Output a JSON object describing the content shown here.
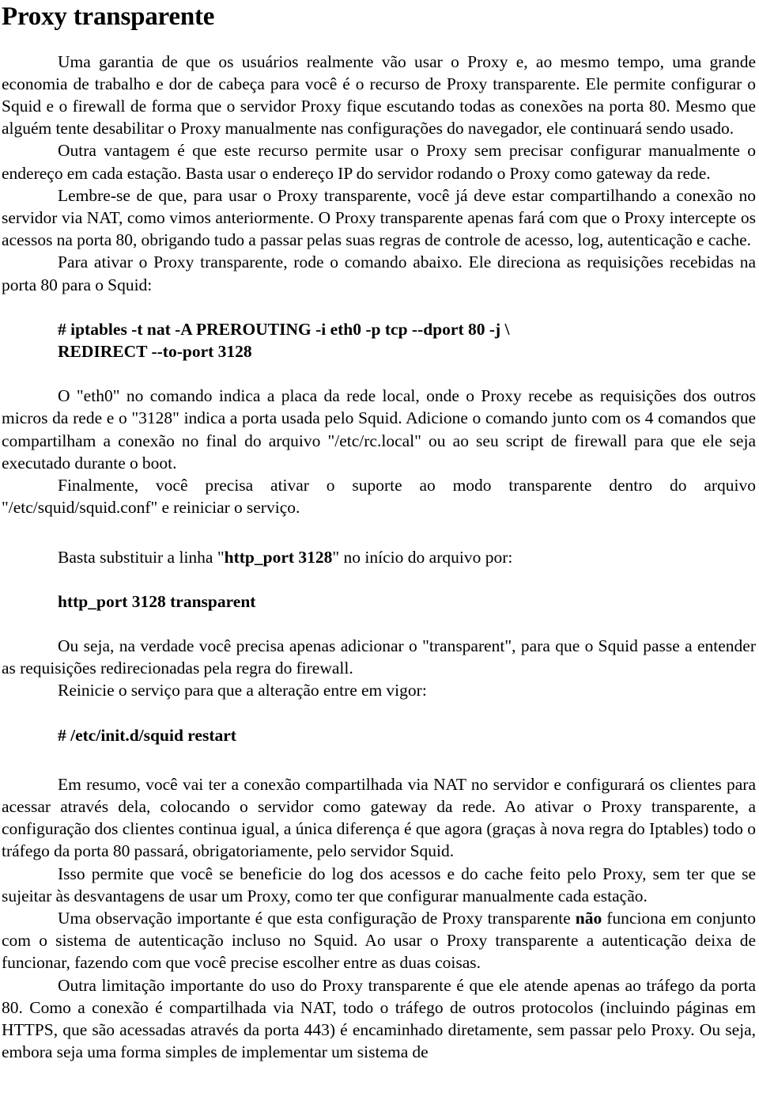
{
  "document": {
    "title": "Proxy transparente",
    "language": "pt-BR",
    "colors": {
      "background": "#ffffff",
      "text": "#000000"
    },
    "blocks": {
      "p1": "Uma garantia de que os usuários realmente vão usar o Proxy e, ao mesmo tempo, uma grande economia de trabalho e dor de cabeça para você é o recurso de Proxy transparente. Ele permite configurar o Squid e o firewall de forma que o servidor Proxy fique escutando todas as conexões na porta 80. Mesmo que alguém tente desabilitar o Proxy manualmente nas configurações do navegador, ele continuará sendo usado.",
      "p2": "Outra vantagem é que este recurso permite usar o Proxy sem precisar configurar manualmente o endereço em cada estação. Basta usar o endereço IP do servidor rodando o Proxy como gateway da rede.",
      "p3": "Lembre-se de que, para usar o Proxy transparente, você já deve estar compartilhando a conexão no servidor via NAT, como vimos anteriormente. O Proxy transparente apenas fará com que o Proxy intercepte os acessos na porta 80, obrigando tudo a passar pelas suas regras de controle de acesso, log, autenticação e cache.",
      "p4": "Para ativar o Proxy transparente, rode o comando abaixo. Ele direciona as requisições recebidas na porta 80 para o Squid:",
      "cmd1_line1": "# iptables -t nat -A PREROUTING -i eth0 -p tcp --dport 80 -j \\",
      "cmd1_line2": "REDIRECT --to-port 3128",
      "p5": "O \"eth0\" no comando indica a placa da rede local, onde o Proxy recebe as requisições dos outros micros da rede e o \"3128\" indica a porta usada pelo Squid. Adicione o comando junto com os 4 comandos que compartilham a conexão no final do arquivo \"/etc/rc.local\" ou ao seu script de firewall para que ele seja executado durante o boot.",
      "p6": "Finalmente, você precisa ativar o suporte ao modo transparente dentro do arquivo \"/etc/squid/squid.conf\" e reiniciar o serviço.",
      "p7_before": "Basta substituir a linha \"",
      "p7_bold": "http_port 3128",
      "p7_after": "\" no início do arquivo por:",
      "cmd2": "http_port 3128 transparent",
      "p8": "Ou seja, na verdade você precisa apenas adicionar o \"transparent\", para que o Squid passe a entender as requisições redirecionadas pela regra do firewall.",
      "p9": "Reinicie o serviço para que a alteração entre em vigor:",
      "cmd3": "# /etc/init.d/squid restart",
      "p10": "Em resumo, você vai ter a conexão compartilhada via NAT no servidor e configurará os clientes para acessar através dela, colocando o servidor como gateway da rede. Ao ativar o Proxy transparente, a configuração dos clientes continua igual, a única diferença é que agora (graças à nova regra do Iptables) todo o tráfego da porta 80 passará, obrigatoriamente, pelo servidor Squid.",
      "p11": "Isso permite que você se beneficie do log dos acessos e do cache feito pelo Proxy, sem ter que se sujeitar às desvantagens de usar um Proxy, como ter que configurar manualmente cada estação.",
      "p12_before": "Uma observação importante é que esta configuração de Proxy transparente ",
      "p12_bold": "não",
      "p12_after": " funciona em conjunto com o sistema de autenticação incluso no Squid. Ao usar o Proxy transparente a autenticação deixa de funcionar, fazendo com que você precise escolher entre as duas coisas.",
      "p13": "Outra limitação importante do uso do Proxy transparente é que ele atende apenas ao tráfego da porta 80. Como a conexão é compartilhada via NAT, todo o tráfego de outros protocolos (incluindo páginas em HTTPS, que são acessadas através da porta 443) é encaminhado diretamente, sem passar pelo Proxy. Ou seja, embora seja uma forma simples de implementar um sistema de"
    }
  }
}
